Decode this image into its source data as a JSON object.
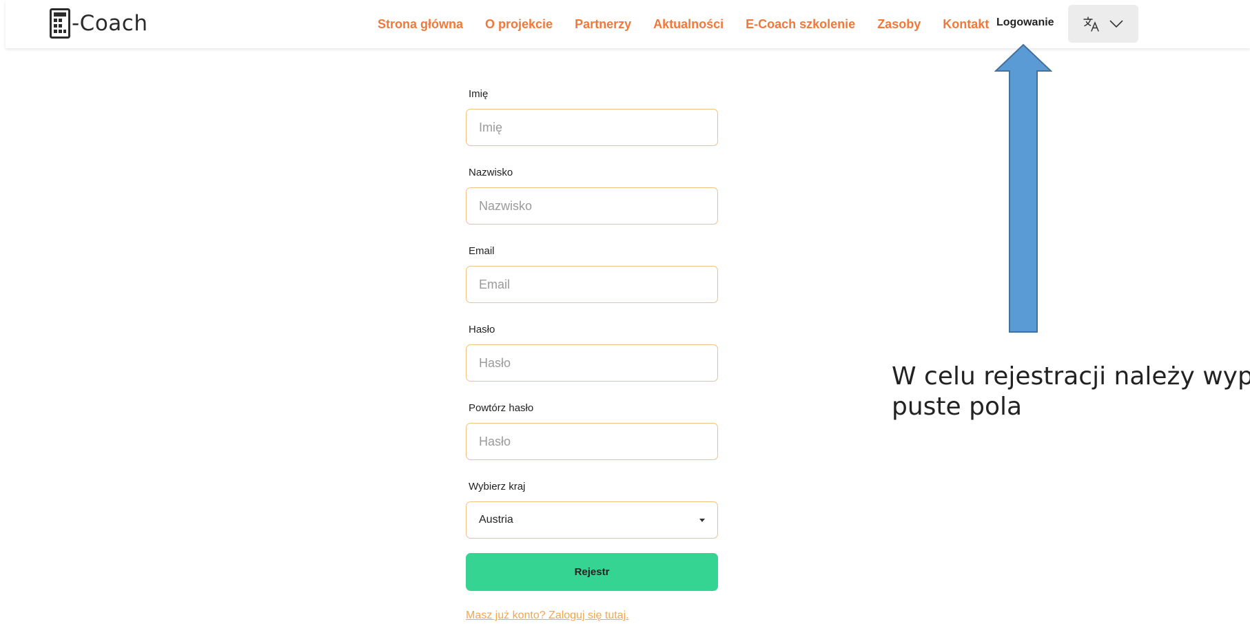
{
  "header": {
    "logo_text": "-Coach",
    "nav": [
      {
        "label": "Strona główna"
      },
      {
        "label": "O projekcie"
      },
      {
        "label": "Partnerzy"
      },
      {
        "label": "Aktualności"
      },
      {
        "label": "E-Coach szkolenie"
      },
      {
        "label": "Zasoby"
      },
      {
        "label": "Kontakt"
      }
    ],
    "login_label": "Logowanie",
    "language_icon": "translate-icon"
  },
  "form": {
    "first_name": {
      "label": "Imię",
      "placeholder": "Imię",
      "value": ""
    },
    "last_name": {
      "label": "Nazwisko",
      "placeholder": "Nazwisko",
      "value": ""
    },
    "email": {
      "label": "Email",
      "placeholder": "Email",
      "value": ""
    },
    "password": {
      "label": "Hasło",
      "placeholder": "Hasło",
      "value": ""
    },
    "repeat_password": {
      "label": "Powtórz hasło",
      "placeholder": "Hasło",
      "value": ""
    },
    "country": {
      "label": "Wybierz kraj",
      "selected": "Austria"
    },
    "submit_label": "Rejestr",
    "login_link": "Masz już konto? Zaloguj się tutaj."
  },
  "annotation": {
    "line1": "W celu rejestracji należy wypełnić",
    "line2": "puste pola"
  },
  "colors": {
    "nav_accent": "#f2783a",
    "input_border": "#f3c27f",
    "submit_bg": "#36d493",
    "link": "#f3a64a",
    "arrow_fill": "#5b9bd5",
    "arrow_stroke": "#41719c"
  }
}
